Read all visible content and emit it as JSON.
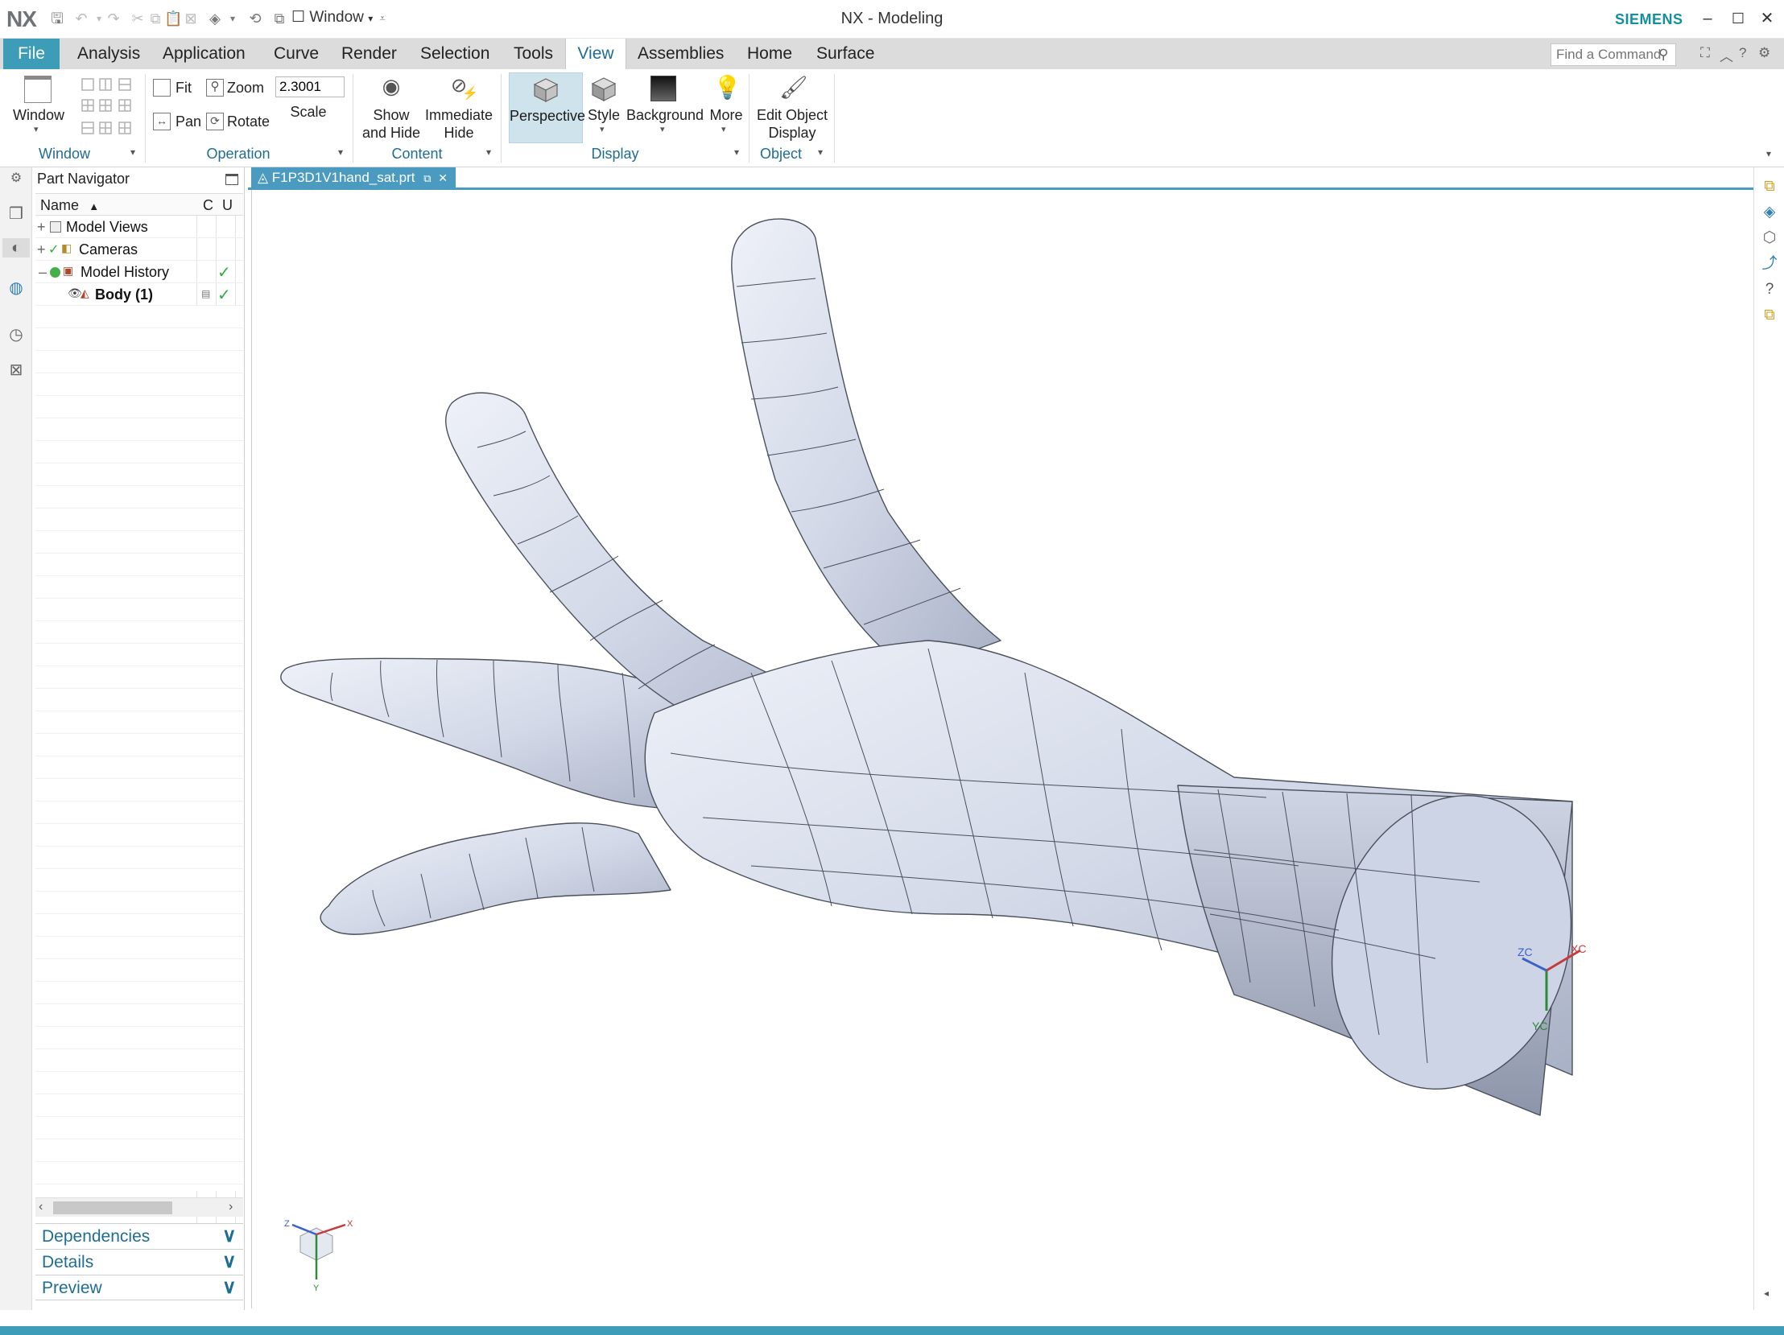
{
  "titlebar": {
    "logo": "NX",
    "window_menu": "Window",
    "title": "NX - Modeling",
    "brand": "SIEMENS",
    "minimize": "–",
    "maximize": "☐",
    "close": "✕"
  },
  "menubar": {
    "items": [
      "File",
      "Analysis",
      "Application",
      "Curve",
      "Render",
      "Selection",
      "Tools",
      "View",
      "Assemblies",
      "Home",
      "Surface"
    ],
    "active": "View",
    "search_placeholder": "Find a Command"
  },
  "ribbon": {
    "window_group": {
      "label": "Window",
      "window_button": "Window"
    },
    "operation_group": {
      "label": "Operation",
      "fit": "Fit",
      "zoom": "Zoom",
      "pan": "Pan",
      "rotate": "Rotate",
      "scale_value": "2.3001",
      "scale_label": "Scale"
    },
    "content_group": {
      "label": "Content",
      "show_hide_1": "Show",
      "show_hide_2": "and Hide",
      "immediate_hide_1": "Immediate",
      "immediate_hide_2": "Hide"
    },
    "display_group": {
      "label": "Display",
      "perspective": "Perspective",
      "style": "Style",
      "background": "Background",
      "more": "More"
    },
    "object_group": {
      "label": "Object",
      "edit_object_display_1": "Edit Object",
      "edit_object_display_2": "Display"
    }
  },
  "part_navigator": {
    "title": "Part Navigator",
    "columns": {
      "name": "Name",
      "c": "C",
      "u": "U"
    },
    "rows": [
      {
        "label": "Model Views",
        "expand": "+"
      },
      {
        "label": "Cameras",
        "expand": "+"
      },
      {
        "label": "Model History",
        "expand": "–"
      },
      {
        "label": "Body (1)"
      }
    ],
    "panels": {
      "dependencies": "Dependencies",
      "details": "Details",
      "preview": "Preview"
    }
  },
  "graphics": {
    "tab_label": "F1P3D1V1hand_sat.prt",
    "csys": {
      "x": "XC",
      "y": "YC",
      "z": "ZC"
    },
    "triad": {
      "x": "X",
      "y": "Y",
      "z": "Z"
    }
  },
  "colors": {
    "accent": "#3d9cb8",
    "brand": "#12909e",
    "active_tab_text": "#1f6d92",
    "model_fill": "#c9d1e3"
  }
}
